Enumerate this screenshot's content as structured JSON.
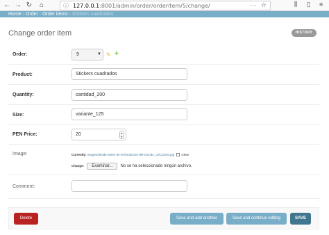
{
  "browser": {
    "url_host": "127.0.0.1",
    "url_path": ":8001/admin/order/orderitem/5/change/",
    "more_label": "···",
    "toolbar_icons": [
      "back-icon",
      "forward-icon",
      "reload-icon",
      "home-icon",
      "library-icon",
      "sidebar-icon",
      "menu-icon"
    ]
  },
  "breadcrumbs": {
    "home": "Home",
    "sep1": " › ",
    "app": "Order",
    "sep2": " › ",
    "model": "Order items",
    "sep3": " › ",
    "current": "Stickers cuadrados"
  },
  "page": {
    "title": "Change order item",
    "history": "HISTORY"
  },
  "form": {
    "order_label": "Order:",
    "order_value": "9",
    "product_label": "Product:",
    "product_value": "Stickers cuadrados",
    "quantity_label": "Quantity:",
    "quantity_value": "cantidad_200",
    "size_label": "Size:",
    "size_value": "variante_125",
    "price_label": "PEN Price:",
    "price_value": "20",
    "image_label": "Image:",
    "currently_label": "Currently:",
    "currently_file": "images/desde-antes-de-la-fundacion-del-mundo_o2CZZO6.jpg",
    "clear_label": "Clear",
    "change_label": "Change:",
    "browse_label": "Examinar...",
    "no_file_text": "No se ha seleccionado ningún archivo.",
    "comment_label": "Comment:",
    "comment_value": ""
  },
  "actions": {
    "delete": "Delete",
    "save_add_another": "Save and add another",
    "save_continue": "Save and continue editing",
    "save": "SAVE"
  },
  "colors": {
    "breadcrumb_bg": "#79aec8",
    "primary": "#417690",
    "delete": "#ba2121",
    "history_bg": "#999999"
  }
}
